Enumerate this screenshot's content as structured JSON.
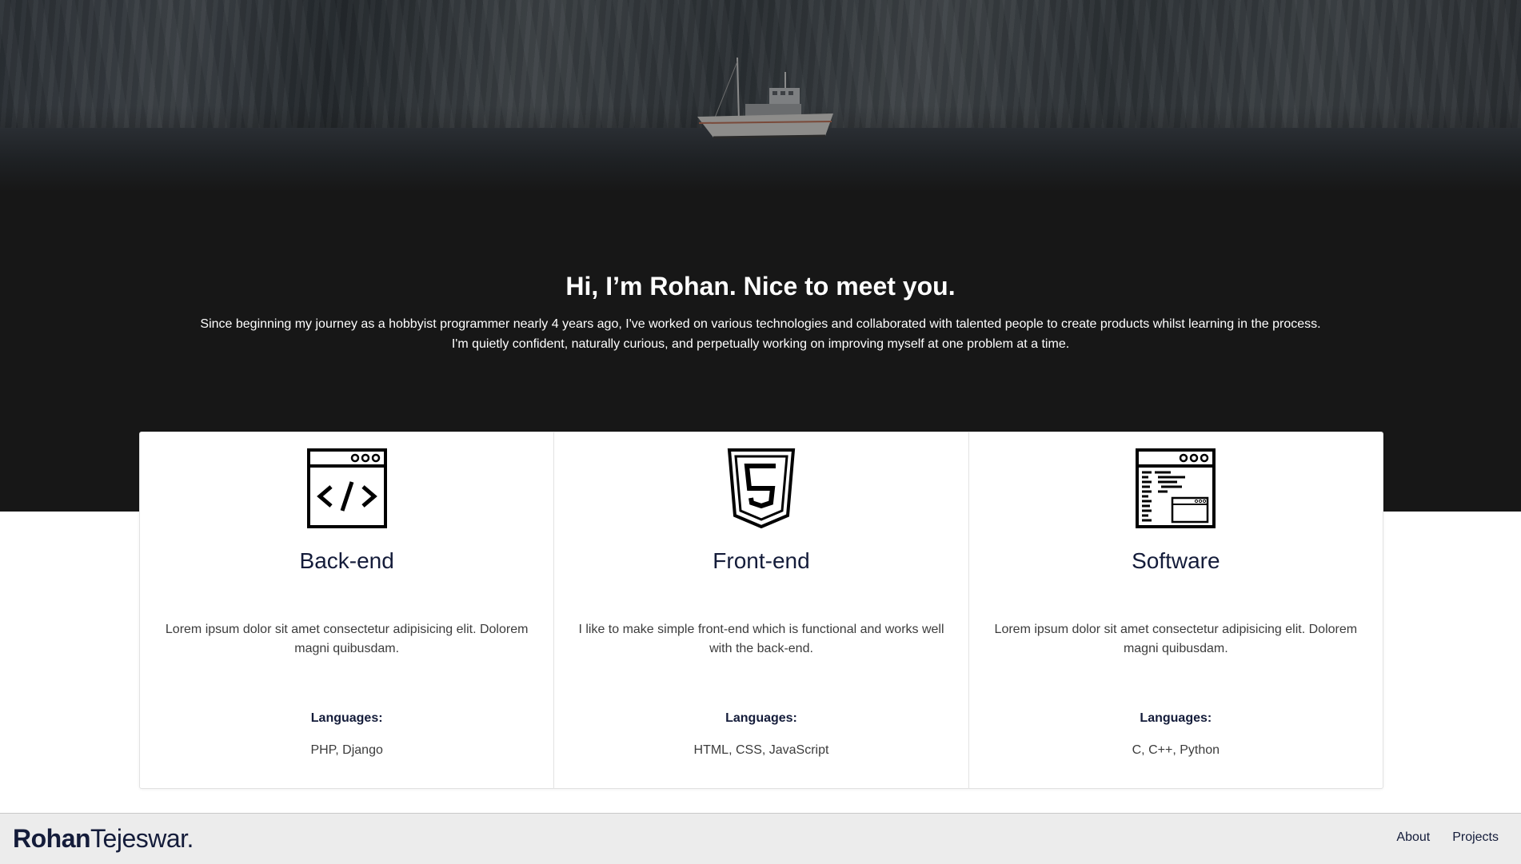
{
  "hero": {
    "title": "Hi, I’m Rohan. Nice to meet you.",
    "intro_line1": "Since beginning my journey as a hobbyist programmer nearly 4 years ago, I've worked on various technologies and collaborated with talented people to create products whilst learning in the process.",
    "intro_line2": "I'm quietly confident, naturally curious, and perpetually working on improving myself at one problem at a time."
  },
  "cards": [
    {
      "icon": "code-window-icon",
      "title": "Back-end",
      "description": "Lorem ipsum dolor sit amet consectetur adipisicing elit. Dolorem magni quibusdam.",
      "languages_label": "Languages:",
      "languages": "PHP, Django"
    },
    {
      "icon": "html5-icon",
      "title": "Front-end",
      "description": "I like to make simple front-end which is functional and works well with the back-end.",
      "languages_label": "Languages:",
      "languages": "HTML, CSS, JavaScript"
    },
    {
      "icon": "software-window-icon",
      "title": "Software",
      "description": "Lorem ipsum dolor sit amet consectetur adipisicing elit. Dolorem magni quibusdam.",
      "languages_label": "Languages:",
      "languages": "C, C++, Python"
    }
  ],
  "navbar": {
    "brand_first": "Rohan",
    "brand_last": "Tejeswar.",
    "links": [
      "About",
      "Projects"
    ]
  },
  "colors": {
    "hero_dark": "#171717",
    "heading_text": "#141c3a",
    "navbar_bg": "#ececec"
  }
}
